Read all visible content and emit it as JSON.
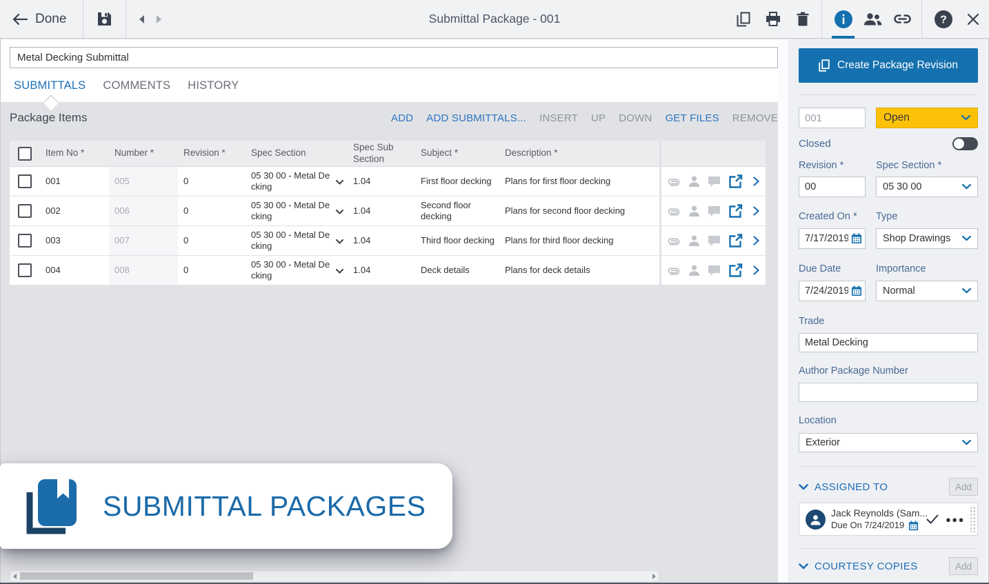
{
  "colors": {
    "accent_blue": "#1470ae",
    "link_blue": "#2b74c0",
    "status_open_yellow": "#fdc107",
    "toolbar_icon_dark": "#39414e",
    "banner_text_blue": "#1a6aa9",
    "avatar_navy": "#1c4a74"
  },
  "toolbar": {
    "done_label": "Done",
    "title": "Submittal Package - 001"
  },
  "package": {
    "title_value": "Metal Decking Submittal"
  },
  "tabs": [
    {
      "label": "SUBMITTALS",
      "active": true
    },
    {
      "label": "COMMENTS",
      "active": false
    },
    {
      "label": "HISTORY",
      "active": false
    }
  ],
  "package_items": {
    "heading": "Package Items",
    "actions": [
      {
        "label": "ADD",
        "enabled": true
      },
      {
        "label": "ADD SUBMITTALS...",
        "enabled": true
      },
      {
        "label": "INSERT",
        "enabled": false
      },
      {
        "label": "UP",
        "enabled": false
      },
      {
        "label": "DOWN",
        "enabled": false
      },
      {
        "label": "GET FILES",
        "enabled": true
      },
      {
        "label": "REMOVE",
        "enabled": false
      }
    ],
    "columns": [
      "Item No *",
      "Number *",
      "Revision *",
      "Spec Section",
      "Spec Sub Section",
      "Subject *",
      "Description *"
    ],
    "rows": [
      {
        "item_no": "001",
        "number": "005",
        "revision": "0",
        "spec_section": "05 30 00 - Metal Decking",
        "spec_sub_section": "1.04",
        "subject": "First floor decking",
        "description": "Plans for first floor decking"
      },
      {
        "item_no": "002",
        "number": "006",
        "revision": "0",
        "spec_section": "05 30 00 - Metal Decking",
        "spec_sub_section": "1.04",
        "subject": "Second floor decking",
        "description": "Plans for second floor decking"
      },
      {
        "item_no": "003",
        "number": "007",
        "revision": "0",
        "spec_section": "05 30 00 - Metal Decking",
        "spec_sub_section": "1.04",
        "subject": "Third floor decking",
        "description": "Plans for third floor decking"
      },
      {
        "item_no": "004",
        "number": "008",
        "revision": "0",
        "spec_section": "05 30 00 - Metal Decking",
        "spec_sub_section": "1.04",
        "subject": "Deck details",
        "description": "Plans for deck details"
      }
    ]
  },
  "sidebar": {
    "create_revision_label": "Create Package Revision",
    "package_number": "001",
    "status_value": "Open",
    "closed_label": "Closed",
    "fields": {
      "revision": {
        "label": "Revision *",
        "value": "00"
      },
      "spec_section": {
        "label": "Spec Section *",
        "value": "05 30 00"
      },
      "created_on": {
        "label": "Created On *",
        "value": "7/17/2019"
      },
      "type": {
        "label": "Type",
        "value": "Shop Drawings"
      },
      "due_date": {
        "label": "Due Date",
        "value": "7/24/2019"
      },
      "importance": {
        "label": "Importance",
        "value": "Normal"
      },
      "trade": {
        "label": "Trade",
        "value": "Metal Decking"
      },
      "author_package_number": {
        "label": "Author Package Number",
        "value": ""
      },
      "location": {
        "label": "Location",
        "value": "Exterior"
      }
    },
    "assigned_to": {
      "heading": "ASSIGNED TO",
      "add_label": "Add",
      "person": {
        "name": "Jack Reynolds (Sam...",
        "due_on": "Due On 7/24/2019"
      }
    },
    "courtesy_copies": {
      "heading": "COURTESY COPIES",
      "add_label": "Add"
    }
  },
  "banner": {
    "label": "SUBMITTAL PACKAGES"
  }
}
